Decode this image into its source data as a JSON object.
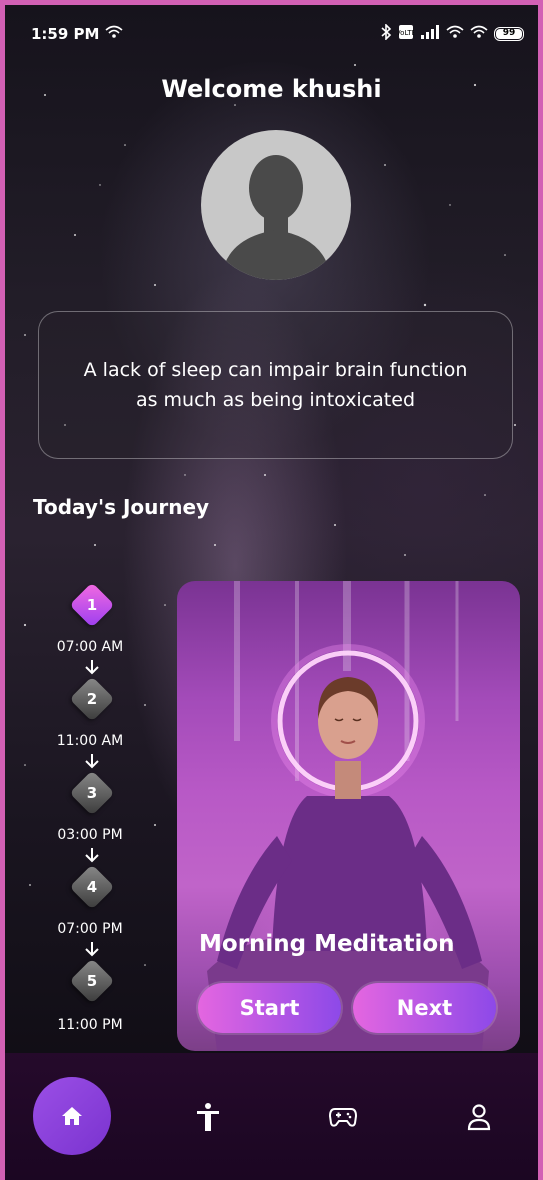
{
  "status_bar": {
    "time": "1:59 PM",
    "battery": "99"
  },
  "header": {
    "welcome": "Welcome khushi"
  },
  "quote": {
    "text": "A lack of sleep can impair brain function as much as being intoxicated"
  },
  "journey": {
    "title": "Today's Journey",
    "steps": [
      {
        "number": "1",
        "time": "07:00 AM",
        "active": true
      },
      {
        "number": "2",
        "time": "11:00 AM",
        "active": false
      },
      {
        "number": "3",
        "time": "03:00 PM",
        "active": false
      },
      {
        "number": "4",
        "time": "07:00 PM",
        "active": false
      },
      {
        "number": "5",
        "time": "11:00 PM",
        "active": false
      }
    ]
  },
  "activity_card": {
    "title": "Morning Meditation",
    "start_label": "Start",
    "next_label": "Next"
  },
  "bottom_nav": {
    "items": [
      "home-icon",
      "yoga-icon",
      "gamepad-icon",
      "profile-icon"
    ],
    "active": "home"
  },
  "colors": {
    "accent": "#8d49e8",
    "accent_pink": "#e466e0",
    "frame": "#d260b4",
    "nav_bg": "#250a2b"
  }
}
